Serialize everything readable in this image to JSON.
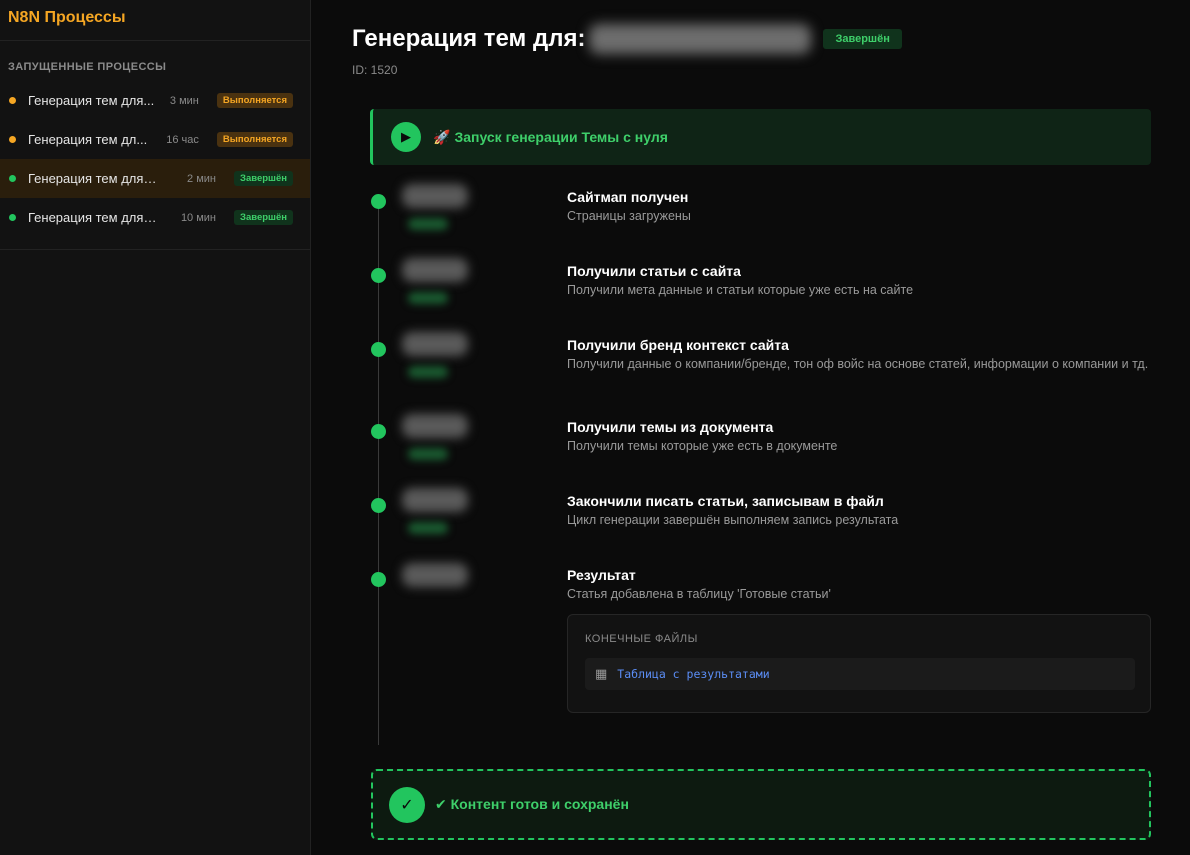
{
  "app": {
    "title": "N8N Процессы"
  },
  "sidebar": {
    "section_title": "ЗАПУЩЕННЫЕ ПРОЦЕССЫ",
    "items": [
      {
        "name": "Генерация тем для...",
        "time": "3 мин",
        "status": "Выполняется",
        "state": "running",
        "active": false
      },
      {
        "name": "Генерация тем дл...",
        "time": "16 час",
        "status": "Выполняется",
        "state": "running",
        "active": false
      },
      {
        "name": "Генерация тем для: ht...",
        "time": "2 мин",
        "status": "Завершён",
        "state": "done",
        "active": true
      },
      {
        "name": "Генерация тем для: ...",
        "time": "10 мин",
        "status": "Завершён",
        "state": "done",
        "active": false
      }
    ]
  },
  "main": {
    "title": "Генерация тем для:",
    "status": "Завершён",
    "id_label": "ID: 1520",
    "start_banner": {
      "icon": "🚀",
      "text": "Запуск генерации Темы с нуля"
    },
    "steps": [
      {
        "title": "Сайтмап получен",
        "desc": "Страницы загружены"
      },
      {
        "title": "Получили статьи с сайта",
        "desc": "Получили мета данные и статьи которые уже есть на сайте"
      },
      {
        "title": "Получили бренд контекст сайта",
        "desc": "Получили данные о компании/бренде, тон оф войс на основе статей, информации о компании и тд."
      },
      {
        "title": "Получили темы из документа",
        "desc": "Получили темы которые уже есть в документе"
      },
      {
        "title": "Закончили писать статьи, записывам в файл",
        "desc": "Цикл генерации завершён выполняем запись результата"
      },
      {
        "title": "Результат",
        "desc": "Статья добавлена в таблицу 'Готовые статьи'"
      }
    ],
    "files": {
      "title": "КОНЕЧНЫЕ ФАЙЛЫ",
      "items": [
        {
          "label": "Таблица с результатами"
        }
      ]
    },
    "done_banner": {
      "text": "✔ Контент готов и сохранён"
    }
  },
  "colors": {
    "accent_orange": "#f5a623",
    "accent_green": "#22c55e",
    "link_blue": "#5b8df5"
  }
}
